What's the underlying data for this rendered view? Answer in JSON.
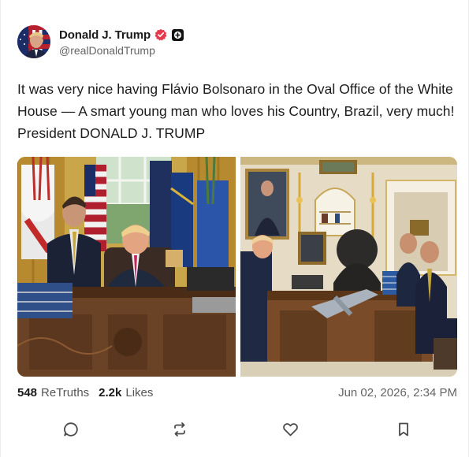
{
  "post": {
    "author": {
      "display_name": "Donald J. Trump",
      "handle": "@realDonaldTrump",
      "verified": true
    },
    "text": "It was very nice having Flávio Bolsonaro in the Oval Office of the White House — A smart young man who loves his Country, Brazil, very much! President DONALD J. TRUMP",
    "media": [
      {
        "kind": "photo",
        "alt": ""
      },
      {
        "kind": "photo",
        "alt": ""
      }
    ],
    "stats": {
      "retruths_count": "548",
      "retruths_label": "ReTruths",
      "likes_count": "2.2k",
      "likes_label": "Likes"
    },
    "timestamp": "Jun 02, 2026, 2:34 PM"
  },
  "actions": {
    "reply_icon": "comment-icon",
    "retruth_icon": "retruth-icon",
    "like_icon": "heart-icon",
    "bookmark_icon": "bookmark-icon"
  },
  "colors": {
    "verified_badge": "#e5394c",
    "text_primary": "#1c1c1c",
    "text_secondary": "#656565"
  }
}
